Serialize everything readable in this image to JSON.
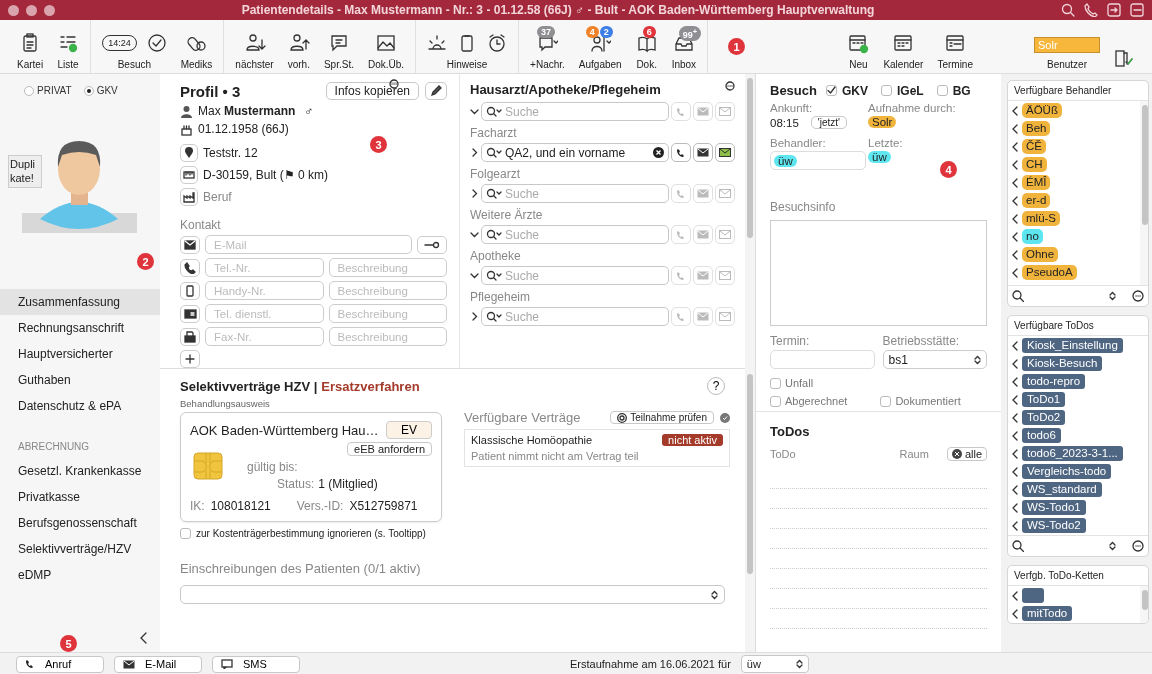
{
  "window": {
    "title": "Patientendetails - Max Mustermann - Nr.: 3 - 01.12.58 (66J) ♂ - Bult - AOK Baden-Württemberg Hauptverwaltung"
  },
  "toolbar": {
    "groups": [
      [
        {
          "label": "Kartei"
        },
        {
          "label": "Liste"
        }
      ],
      [
        {
          "label": "Besuch",
          "clock": "14:24"
        },
        {
          "label": "Mediks"
        }
      ],
      [
        {
          "label": "nächster"
        },
        {
          "label": "vorh."
        },
        {
          "label": "Spr.St."
        },
        {
          "label": "Dok.Üb."
        }
      ],
      [
        {
          "label": "Hinweise"
        }
      ],
      [
        {
          "label": "+Nachr.",
          "badges": [
            {
              "text": "37",
              "color": "#8e8e93"
            }
          ]
        },
        {
          "label": "Aufgaben",
          "badges": [
            {
              "text": "4",
              "color": "#f0832a"
            },
            {
              "text": "2",
              "color": "#3d7fe6"
            }
          ]
        },
        {
          "label": "Dok.",
          "badges": [
            {
              "text": "6",
              "color": "#e0343c"
            }
          ]
        },
        {
          "label": "Inbox",
          "badges": [
            {
              "text": "99$^{+}$",
              "color": "#8e8e93"
            }
          ]
        }
      ]
    ],
    "marker": "1",
    "right_groups": [
      [
        {
          "label": "Neu"
        },
        {
          "label": "Kalender"
        },
        {
          "label": "Termine"
        }
      ]
    ],
    "user": {
      "label": "Benutzer",
      "value": "Solr"
    }
  },
  "sidebar": {
    "insurance": [
      {
        "label": "PRIVAT",
        "selected": false
      },
      {
        "label": "GKV",
        "selected": true
      }
    ],
    "duplicate_badge": "Duplikate!",
    "avatar_marker": "2",
    "items": [
      {
        "label": "Zusammenfassung",
        "selected": true
      },
      {
        "label": "Rechnungsanschrift",
        "selected": false
      },
      {
        "label": "Hauptversicherter",
        "selected": false
      },
      {
        "label": "Guthaben",
        "selected": false
      },
      {
        "label": "Datenschutz & ePA",
        "selected": false
      }
    ],
    "section": "ABRECHNUNG",
    "section_items": [
      {
        "label": "Gesetzl. Krankenkasse",
        "selected": false
      },
      {
        "label": "Privatkasse",
        "selected": false
      },
      {
        "label": "Berufsgenossenschaft",
        "selected": false
      },
      {
        "label": "Selektivverträge/HZV",
        "selected": false
      },
      {
        "label": "eDMP",
        "selected": false
      }
    ],
    "marker": "5"
  },
  "profile": {
    "title": "Profil • 3",
    "copy_button": "Infos kopieren",
    "marker": "3",
    "name": "Max **Mustermann**",
    "gender": "♂",
    "birth": "01.12.1958 (66J)",
    "street": "Teststr. 12",
    "city": "D-30159, Bult (⚑ 0 km)",
    "job_placeholder": "Beruf",
    "contact_label": "Kontakt",
    "contacts": [
      {
        "fields": [
          "E-Mail"
        ]
      },
      {
        "fields": [
          "Tel.-Nr.",
          "Beschreibung"
        ]
      },
      {
        "fields": [
          "Handy-Nr.",
          "Beschreibung"
        ]
      },
      {
        "fields": [
          "Tel. dienstl.",
          "Beschreibung"
        ]
      },
      {
        "fields": [
          "Fax-Nr.",
          "Beschreibung"
        ]
      }
    ]
  },
  "doctors": {
    "title": "Hausarzt/Apotheke/Pflegeheim",
    "rows": [
      {
        "expanded": true,
        "placeholder": "Suche",
        "green_mail": false
      },
      {
        "label": "Facharzt",
        "expanded": false,
        "value": "QA2, und ein vorname",
        "green_mail": true
      },
      {
        "label": "Folgearzt",
        "expanded": false,
        "placeholder": "Suche",
        "green_mail": false
      },
      {
        "label": "Weitere Ärzte",
        "expanded": true,
        "placeholder": "Suche",
        "green_mail": false
      },
      {
        "label": "Apotheke",
        "expanded": true,
        "placeholder": "Suche",
        "green_mail": false
      },
      {
        "label": "Pflegeheim",
        "expanded": false,
        "placeholder": "Suche",
        "green_mail": false
      }
    ]
  },
  "contracts": {
    "title": "Selektivverträge HZV |",
    "subtitle": "Ersatzverfahren",
    "help": "?",
    "card_label": "Behandlungsausweis",
    "insurer": "AOK Baden-Württemberg Hau…",
    "ev_button": "EV",
    "eeb_button": "eEB anfordern",
    "valid_label": "gültig bis:",
    "status_label": "Status:",
    "status": "1 (Mitglied)",
    "ik_label": "IK:",
    "ik": "108018121",
    "vers_label": "Vers.-ID:",
    "vers": "X512759871",
    "ignore": {
      "label": "zur Kostenträgerbestimmung ignorieren (s. Tooltipp)",
      "checked": false
    },
    "available_label": "Verfügbare Verträge",
    "check_button": "Teilnahme prüfen",
    "available": [
      {
        "name": "Klassische Homöopathie",
        "status": "nicht aktiv",
        "note": "Patient nimmt nicht am Vertrag teil"
      }
    ],
    "enrollments": "Einschreibungen des Patienten (0/1 aktiv)"
  },
  "visit": {
    "title": "Besuch",
    "billing": [
      {
        "label": "GKV",
        "checked": true
      },
      {
        "label": "IGeL",
        "checked": false
      },
      {
        "label": "BG",
        "checked": false
      }
    ],
    "arrival_label": "Ankunft:",
    "arrival": "08:15",
    "now_button": "'jetzt'",
    "admitted_label": "Aufnahme durch:",
    "admitted": {
      "text": "Solr",
      "color": "#f0b43c"
    },
    "doctor_label": "Behandler:",
    "doctor": {
      "text": "üw",
      "color": "#5ee6f0"
    },
    "last_label": "Letzte:",
    "last": {
      "text": "üw",
      "color": "#5ee6f0"
    },
    "marker": "4",
    "info_label": "Besuchsinfo",
    "appointment_label": "Termin:",
    "site_label": "Betriebsstätte:",
    "site": "bs1",
    "flags": [
      {
        "label": "Unfall",
        "checked": false
      },
      {
        "label": "Abgerechnet",
        "checked": false
      },
      {
        "label": "Dokumentiert",
        "checked": false
      }
    ]
  },
  "todos": {
    "title": "ToDos",
    "col_todo": "ToDo",
    "col_room": "Raum",
    "all_button": "alle"
  },
  "providers": {
    "title": "Verfügbare Behandler",
    "items": [
      {
        "label": "ÄÖÜß",
        "color": "#f0b43c"
      },
      {
        "label": "Beh",
        "color": "#f0b43c"
      },
      {
        "label": "ČĚ",
        "color": "#f0b43c"
      },
      {
        "label": "CH",
        "color": "#f0b43c"
      },
      {
        "label": "ÉMÎ",
        "color": "#f0b43c"
      },
      {
        "label": "er-d",
        "color": "#f0b43c"
      },
      {
        "label": "mlü-S",
        "color": "#f0b43c"
      },
      {
        "label": "no",
        "color": "#5ee6f0"
      },
      {
        "label": "Ohne",
        "color": "#f0b43c"
      },
      {
        "label": "PseudoA",
        "color": "#f0b43c"
      }
    ]
  },
  "todo_list": {
    "title": "Verfügbare ToDos",
    "items": [
      "Kiosk_Einstellung",
      "Kiosk-Besuch",
      "todo-repro",
      "ToDo1",
      "ToDo2",
      "todo6",
      "todo6_2023-3-1...",
      "Vergleichs-todo",
      "WS_standard",
      "WS-Todo1",
      "WS-Todo2"
    ]
  },
  "chains": {
    "title": "Verfgb. ToDo-Ketten",
    "items": [
      {
        "blank": true
      },
      {
        "blank": false,
        "label": "mitTodo"
      }
    ]
  },
  "footer": {
    "buttons": [
      "Anruf",
      "E-Mail",
      "SMS"
    ],
    "note": "Erstaufnahme am 16.06.2021 für",
    "select": "üw"
  }
}
